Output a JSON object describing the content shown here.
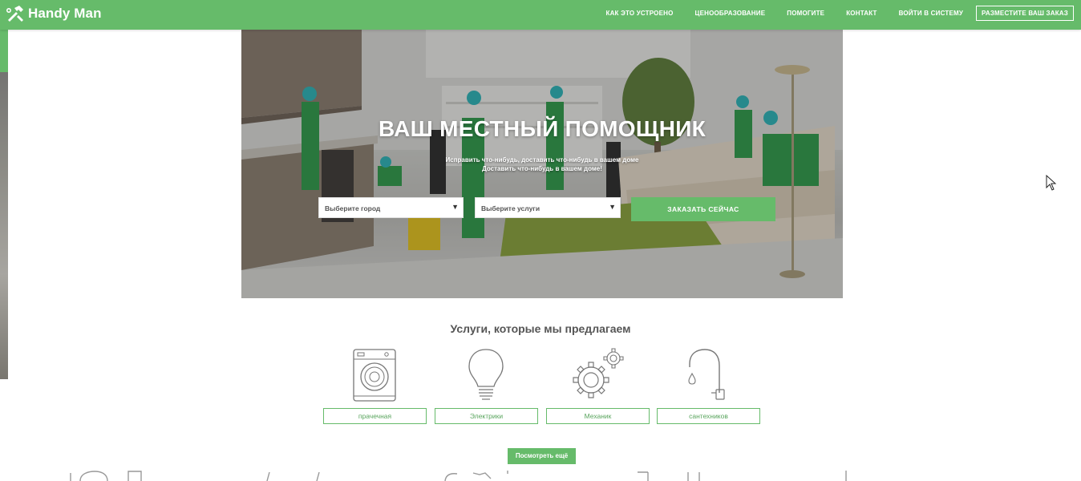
{
  "header": {
    "brand": "Handy Man",
    "nav": [
      {
        "label": "КАК ЭТО УСТРОЕНО"
      },
      {
        "label": "ЦЕНООБРАЗОВАНИЕ"
      },
      {
        "label": "ПОМОГИТЕ"
      },
      {
        "label": "КОНТАКТ"
      },
      {
        "label": "ВОЙТИ В СИСТЕМУ"
      }
    ],
    "order_button": "РАЗМЕСТИТЕ ВАШ ЗАКАЗ"
  },
  "hero": {
    "title": "ВАШ МЕСТНЫЙ ПОМОЩНИК",
    "subtitle_line1": "Исправить что-нибудь, доставить что-нибудь в вашем доме",
    "subtitle_line2": "Доставить что-нибудь в вашем доме!",
    "city_select": "Выберите город",
    "service_select": "Выберите услуги",
    "order_now": "ЗАКАЗАТЬ СЕЙЧАС"
  },
  "services": {
    "title": "Услуги, которые мы предлагаем",
    "items": [
      {
        "label": "прачечная",
        "icon": "washing-machine-icon"
      },
      {
        "label": "Электрики",
        "icon": "light-bulb-icon"
      },
      {
        "label": "Механик",
        "icon": "gears-icon"
      },
      {
        "label": "сантехников",
        "icon": "faucet-icon"
      }
    ],
    "more": "Посмотреть ещё"
  },
  "colors": {
    "brand_green": "#66bb6a",
    "text_gray": "#555555",
    "white": "#ffffff"
  }
}
